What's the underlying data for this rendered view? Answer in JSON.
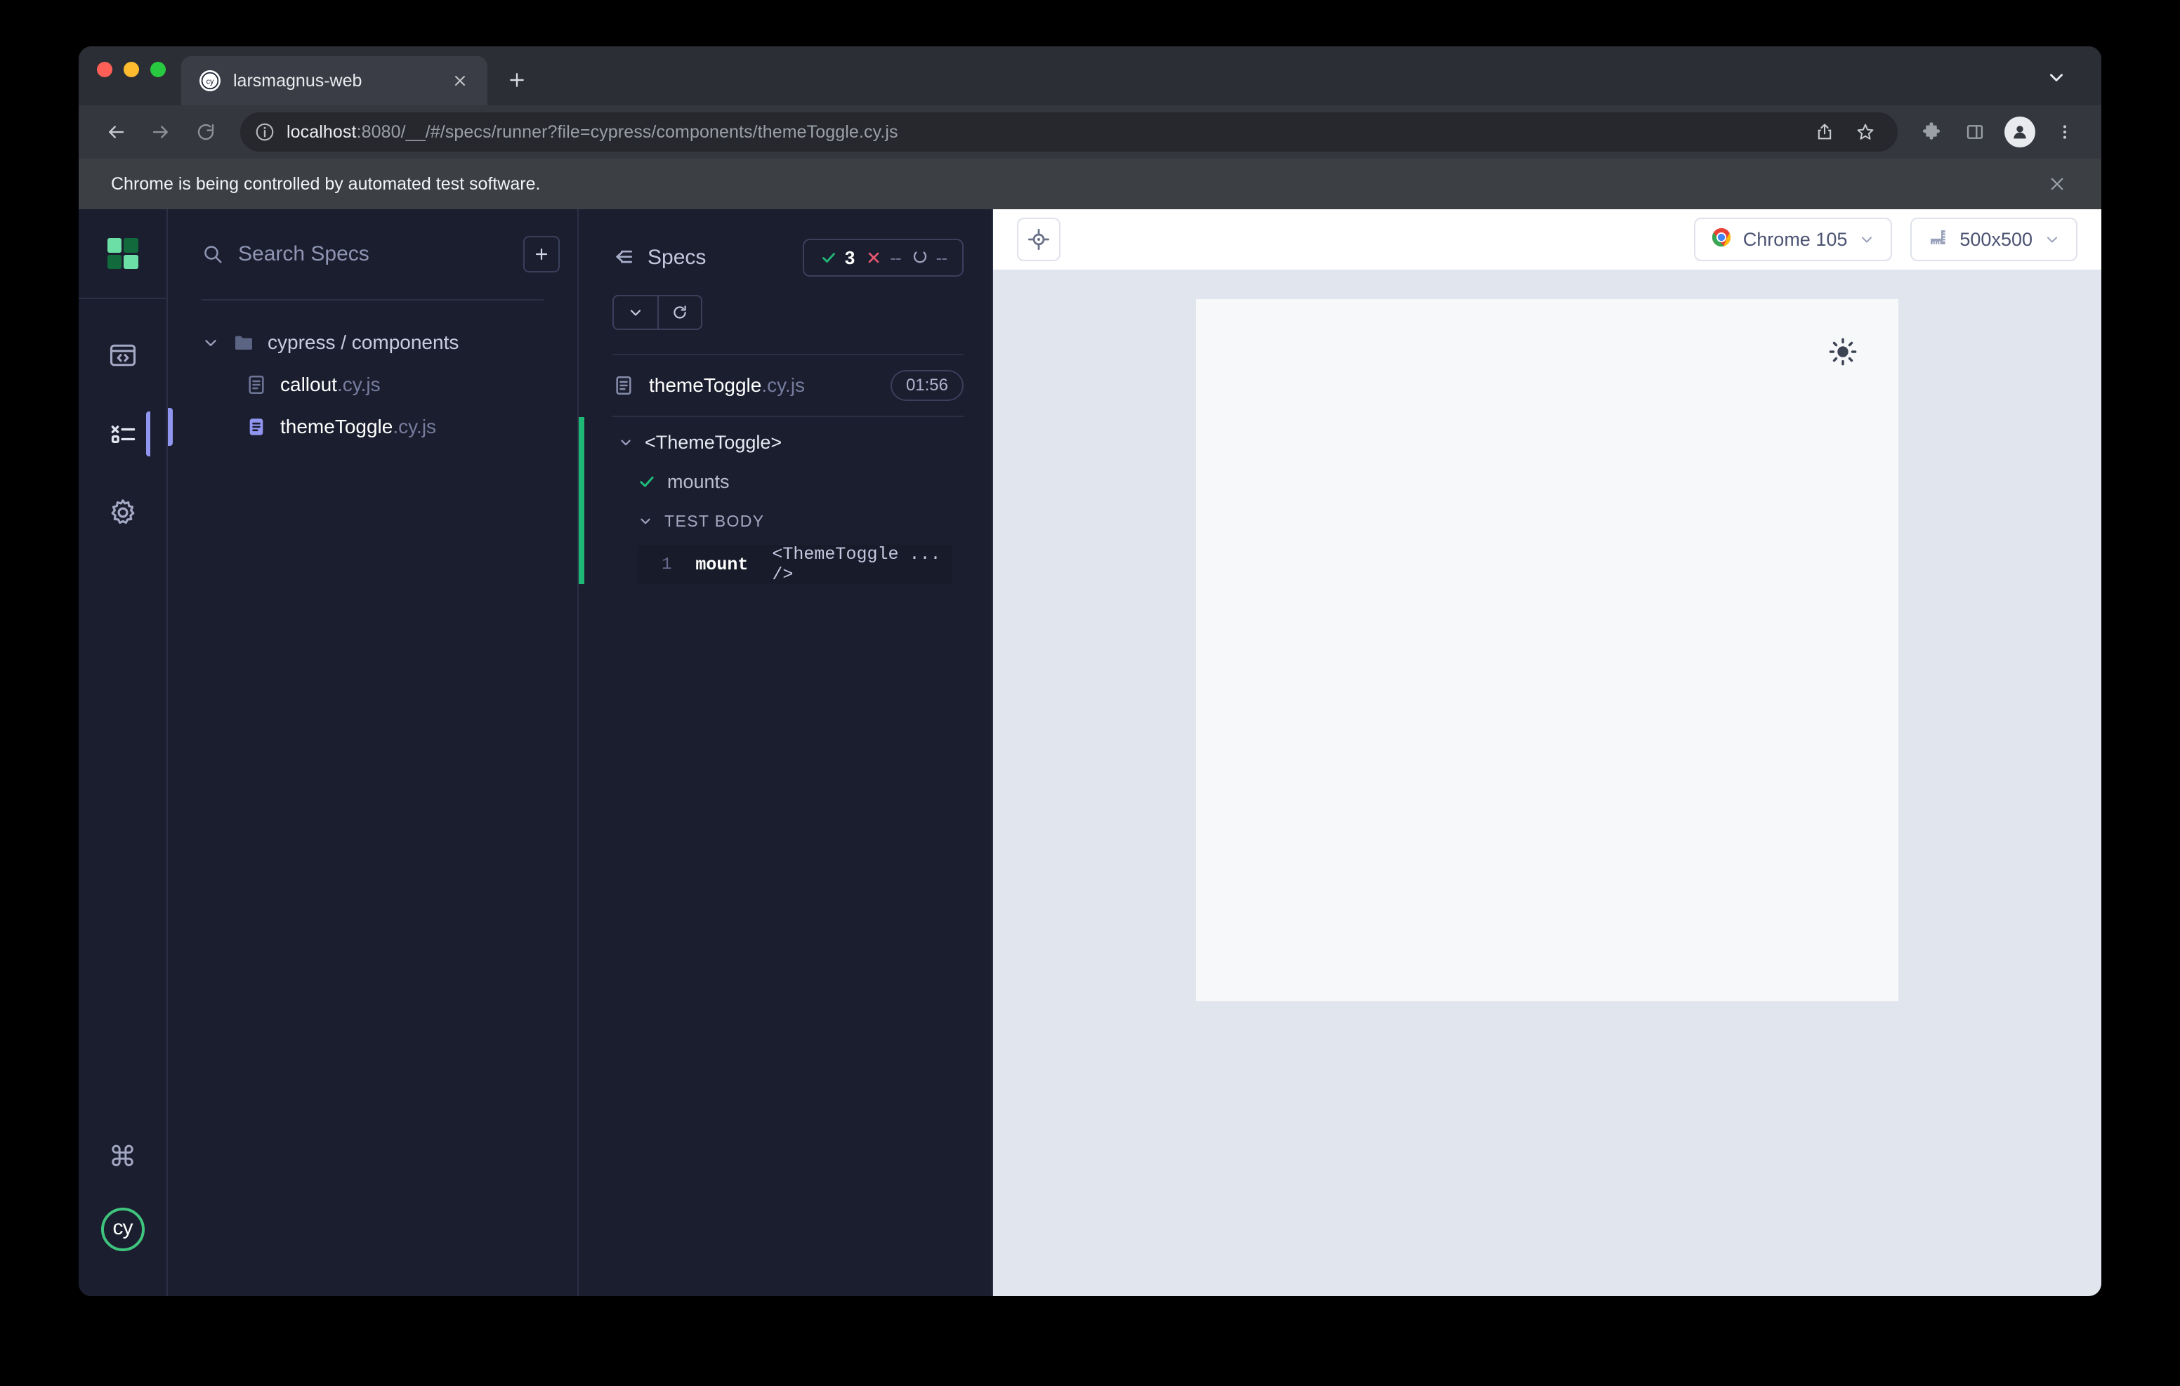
{
  "browser": {
    "tab": {
      "title": "larsmagnus-web",
      "favicon": "cypress-favicon"
    },
    "new_tab_label": "+",
    "url_host": "localhost",
    "url_rest": ":8080/__/#/specs/runner?file=cypress/components/themeToggle.cy.js",
    "infobar_text": "Chrome is being controlled by automated test software.",
    "toolbar_icons": [
      "back-icon",
      "forward-icon",
      "reload-icon",
      "share-icon",
      "bookmark-star-icon",
      "extensions-puzzle-icon",
      "side-panel-icon",
      "profile-avatar-icon",
      "chrome-menu-icon"
    ]
  },
  "rail": {
    "logo_colors": [
      "#6BDFA5",
      "#11693C",
      "#11693C",
      "#6BDFA5"
    ],
    "items": [
      {
        "name": "runs-browser",
        "icon": "browser-code-icon"
      },
      {
        "name": "specs",
        "icon": "specs-list-icon",
        "active": true
      },
      {
        "name": "settings",
        "icon": "gear-icon"
      }
    ],
    "bottom": [
      {
        "name": "keyboard-shortcuts",
        "icon": "command-key-icon",
        "glyph": "⌘"
      },
      {
        "name": "cypress-logo",
        "icon": "cypress-logo-icon",
        "text": "cy"
      }
    ]
  },
  "sidebar": {
    "search_placeholder": "Search Specs",
    "search_value": "",
    "add_spec_label": "+",
    "tree": [
      {
        "type": "folder",
        "label": "cypress / components",
        "expanded": true
      },
      {
        "type": "file",
        "name": "callout",
        "ext": ".cy.js",
        "selected": false
      },
      {
        "type": "file",
        "name": "themeToggle",
        "ext": ".cy.js",
        "selected": true
      }
    ]
  },
  "reporter": {
    "back_label": "Specs",
    "stats": [
      {
        "name": "passed",
        "icon": "check-icon",
        "value": "3",
        "color": "#1FB977"
      },
      {
        "name": "failed",
        "icon": "x-icon",
        "value": "--",
        "color": "#E45770"
      },
      {
        "name": "pending",
        "icon": "pending-icon",
        "value": "--",
        "color": "#9BA1BE"
      }
    ],
    "controls": [
      {
        "name": "collapse-all",
        "icon": "chevron-down-icon"
      },
      {
        "name": "rerun",
        "icon": "reload-icon"
      }
    ],
    "spec_name": "themeToggle",
    "spec_ext": ".cy.js",
    "duration": "01:56",
    "suite": "<ThemeToggle>",
    "test": "mounts",
    "section_label": "TEST BODY",
    "code": {
      "number": "1",
      "command": "mount",
      "argument": "<ThemeToggle ... />"
    }
  },
  "preview": {
    "selector_playground_icon": "crosshair-target-icon",
    "browser_select": {
      "label": "Chrome 105",
      "icon": "chrome-icon"
    },
    "viewport_select": {
      "label": "500x500",
      "icon": "ruler-icon"
    },
    "app": {
      "theme_toggle_icon": "sun-icon"
    }
  }
}
